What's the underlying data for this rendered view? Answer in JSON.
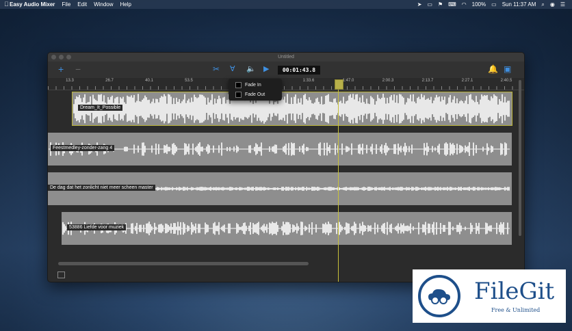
{
  "menubar": {
    "app_name": "Easy Audio Mixer",
    "menus": [
      "File",
      "Edit",
      "Window",
      "Help"
    ],
    "battery": "100%",
    "clock": "Sun 11:37 AM"
  },
  "window": {
    "title": "Untitled",
    "time_display": "00:01:43.8",
    "ruler_labels": [
      "13.3",
      "26.7",
      "40.1",
      "53.5",
      "1:33.6",
      "1:47.0",
      "2:00.3",
      "2:13.7",
      "2:27.1",
      "2:40.5"
    ],
    "dropdown": {
      "fade_in": "Fade In",
      "fade_out": "Fade Out"
    },
    "tracks": [
      {
        "name": "Dream_It_Possible"
      },
      {
        "name": "Feestmedley-zonder-zang  4"
      },
      {
        "name": "De dag dat het zonlicht niet meer scheen master"
      },
      {
        "name": "53886 Liefde voor muziek"
      }
    ]
  },
  "watermark": {
    "brand": "FileGit",
    "tagline": "Free & Unlimited"
  },
  "colors": {
    "accent": "#3f8fe0",
    "playhead": "#c9c23a",
    "track_bg": "#8e8e8e"
  }
}
